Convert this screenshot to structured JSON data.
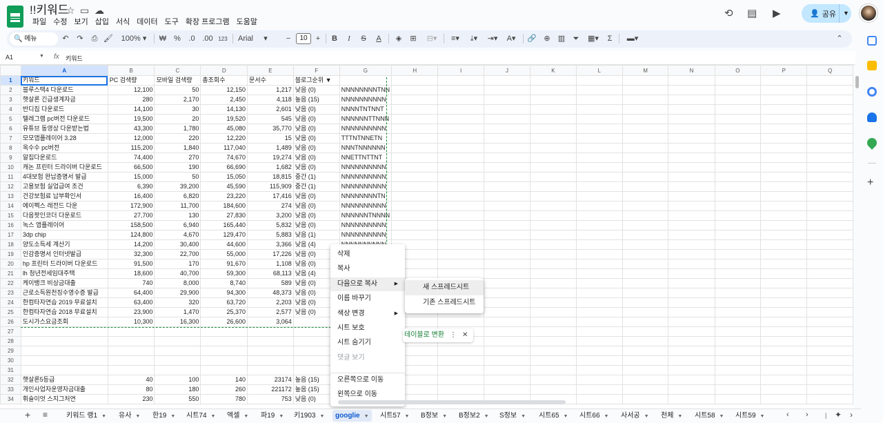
{
  "app": {
    "doc_title": "!!키워드",
    "menus": [
      "파일",
      "수정",
      "보기",
      "삽입",
      "서식",
      "데이터",
      "도구",
      "확장 프로그램",
      "도움말"
    ],
    "share_label": "공유"
  },
  "toolbar": {
    "menu_search": "메뉴",
    "zoom": "100%",
    "currency": "₩",
    "percent": "%",
    "dec_decrease": ".0",
    "dec_increase": ".00",
    "number_format": "123",
    "font": "Arial",
    "font_size": "10"
  },
  "formula": {
    "cell_ref": "A1",
    "value": "키워드"
  },
  "columns": [
    "A",
    "B",
    "C",
    "D",
    "E",
    "F",
    "G",
    "H",
    "I",
    "J",
    "K",
    "L",
    "M",
    "N",
    "O",
    "P",
    "Q"
  ],
  "rows": [
    {
      "n": "1",
      "a": "키워드",
      "b": "PC 검색량",
      "c": "모바일 검색량",
      "d": "총조회수",
      "e": "문서수",
      "f": "블로그순위 ▼",
      "g": ""
    },
    {
      "n": "2",
      "a": "블루스택4 다운로드",
      "b": "12,100",
      "c": "50",
      "d": "12,150",
      "e": "1,217",
      "f": "낮음 (0)",
      "g": "NNNNNNNNTNN"
    },
    {
      "n": "3",
      "a": "햇살론 긴급생계자금",
      "b": "280",
      "c": "2,170",
      "d": "2,450",
      "e": "4,118",
      "f": "높음 (15)",
      "g": "NNNNNNNNNN"
    },
    {
      "n": "4",
      "a": "반디집 다운로드",
      "b": "14,100",
      "c": "30",
      "d": "14,130",
      "e": "2,601",
      "f": "낮음 (0)",
      "g": "NNNNTNTNNT"
    },
    {
      "n": "5",
      "a": "텔레그램 pc버전 다운로드",
      "b": "19,500",
      "c": "20",
      "d": "19,520",
      "e": "545",
      "f": "낮음 (0)",
      "g": "NNNNNNTTNNN"
    },
    {
      "n": "6",
      "a": "유튜브 동영상 다운받는법",
      "b": "43,300",
      "c": "1,780",
      "d": "45,080",
      "e": "35,770",
      "f": "낮음 (0)",
      "g": "NNNNNNNNNN"
    },
    {
      "n": "7",
      "a": "모모앱플레이어 3.28",
      "b": "12,000",
      "c": "220",
      "d": "12,220",
      "e": "15",
      "f": "낮음 (0)",
      "g": "TTTNTNNETN"
    },
    {
      "n": "8",
      "a": "옥수수 pc버전",
      "b": "115,200",
      "c": "1,840",
      "d": "117,040",
      "e": "1,489",
      "f": "낮음 (0)",
      "g": "NNNTNNNNNN"
    },
    {
      "n": "9",
      "a": "알집다운로드",
      "b": "74,400",
      "c": "270",
      "d": "74,670",
      "e": "19,274",
      "f": "낮음 (0)",
      "g": "NNETTNTTNT"
    },
    {
      "n": "10",
      "a": "캐논 프린터 드라이버 다운로드",
      "b": "66,500",
      "c": "190",
      "d": "66,690",
      "e": "1,682",
      "f": "낮음 (0)",
      "g": "NNNNNNNNNN"
    },
    {
      "n": "11",
      "a": "4대보험 완납증명서 발급",
      "b": "15,000",
      "c": "50",
      "d": "15,050",
      "e": "18,815",
      "f": "중간 (1)",
      "g": "NNNNNNNNNN"
    },
    {
      "n": "12",
      "a": "고용보험 실업급여 조건",
      "b": "6,390",
      "c": "39,200",
      "d": "45,590",
      "e": "115,909",
      "f": "중간 (1)",
      "g": "NNNNNNNNNN"
    },
    {
      "n": "13",
      "a": "건강보험료 납부확인서",
      "b": "16,400",
      "c": "6,820",
      "d": "23,220",
      "e": "17,416",
      "f": "낮음 (0)",
      "g": "NNNNNNNNTN"
    },
    {
      "n": "14",
      "a": "에이펙스 레전드 다운",
      "b": "172,900",
      "c": "11,700",
      "d": "184,600",
      "e": "274",
      "f": "낮음 (0)",
      "g": "NNNNNNNNNN"
    },
    {
      "n": "15",
      "a": "다음팟인코더 다운로드",
      "b": "27,700",
      "c": "130",
      "d": "27,830",
      "e": "3,200",
      "f": "낮음 (0)",
      "g": "NNNNNNTNNNN"
    },
    {
      "n": "16",
      "a": "녹스 앱플레이어",
      "b": "158,500",
      "c": "6,940",
      "d": "165,440",
      "e": "5,832",
      "f": "낮음 (0)",
      "g": "NNNNNNNNNN"
    },
    {
      "n": "17",
      "a": "3dp chip",
      "b": "124,800",
      "c": "4,670",
      "d": "129,470",
      "e": "5,883",
      "f": "낮음 (1)",
      "g": "NNNNNNNNNN"
    },
    {
      "n": "18",
      "a": "양도소득세 계산기",
      "b": "14,200",
      "c": "30,400",
      "d": "44,600",
      "e": "3,366",
      "f": "낮음 (4)",
      "g": "NNNNNNNNNN"
    },
    {
      "n": "19",
      "a": "인감증명서 인터넷발급",
      "b": "32,300",
      "c": "22,700",
      "d": "55,000",
      "e": "17,226",
      "f": "낮음 (0)",
      "g": ""
    },
    {
      "n": "20",
      "a": "hp 프린터 드라이버 다운로드",
      "b": "91,500",
      "c": "170",
      "d": "91,670",
      "e": "1,108",
      "f": "낮음 (0)",
      "g": ""
    },
    {
      "n": "21",
      "a": "lh 청년전세임대주택",
      "b": "18,600",
      "c": "40,700",
      "d": "59,300",
      "e": "68,113",
      "f": "낮음 (4)",
      "g": ""
    },
    {
      "n": "22",
      "a": "케이뱅크 비상금대출",
      "b": "740",
      "c": "8,000",
      "d": "8,740",
      "e": "589",
      "f": "낮음 (0)",
      "g": ""
    },
    {
      "n": "23",
      "a": "근로소득원천징수영수증 발급",
      "b": "64,400",
      "c": "29,900",
      "d": "94,300",
      "e": "48,373",
      "f": "낮음 (0)",
      "g": ""
    },
    {
      "n": "24",
      "a": "한컴타자연습 2019 무료설치",
      "b": "63,400",
      "c": "320",
      "d": "63,720",
      "e": "2,203",
      "f": "낮음 (0)",
      "g": ""
    },
    {
      "n": "25",
      "a": "한컴타자연습 2018 무료설치",
      "b": "23,900",
      "c": "1,470",
      "d": "25,370",
      "e": "2,577",
      "f": "낮음 (0)",
      "g": ""
    },
    {
      "n": "26",
      "a": "도시가스요금조회",
      "b": "10,300",
      "c": "16,300",
      "d": "26,600",
      "e": "3,064",
      "f": "",
      "g": ""
    },
    {
      "n": "27",
      "a": "",
      "b": "",
      "c": "",
      "d": "",
      "e": "",
      "f": "",
      "g": ""
    },
    {
      "n": "28",
      "a": "",
      "b": "",
      "c": "",
      "d": "",
      "e": "",
      "f": "",
      "g": ""
    },
    {
      "n": "29",
      "a": "",
      "b": "",
      "c": "",
      "d": "",
      "e": "",
      "f": "",
      "g": ""
    },
    {
      "n": "30",
      "a": "",
      "b": "",
      "c": "",
      "d": "",
      "e": "",
      "f": "",
      "g": ""
    },
    {
      "n": "31",
      "a": "",
      "b": "",
      "c": "",
      "d": "",
      "e": "",
      "f": "",
      "g": ""
    },
    {
      "n": "32",
      "a": "햇살론5등급",
      "b": "40",
      "c": "100",
      "d": "140",
      "e": "23174",
      "f": "높음 (15)",
      "g": ""
    },
    {
      "n": "33",
      "a": "개인사업자운영자금대출",
      "b": "80",
      "c": "180",
      "d": "260",
      "e": "221172",
      "f": "높음 (15)",
      "g": ""
    },
    {
      "n": "34",
      "a": "휘슬이엇 스지그처연",
      "b": "230",
      "c": "550",
      "d": "780",
      "e": "753",
      "f": "낮음 (0)",
      "g": ""
    }
  ],
  "context_menu": {
    "items": [
      "삭제",
      "복사",
      "다음으로 복사",
      "이름 바꾸기",
      "색상 변경",
      "시트 보호",
      "시트 숨기기",
      "댓글 보기",
      "오른쪽으로 이동",
      "왼쪽으로 이동"
    ]
  },
  "submenu": {
    "items": [
      "새 스프레드시트",
      "기존 스프레드시트"
    ]
  },
  "convert_chip": {
    "label": "테이블로 변환"
  },
  "sheet_tabs": [
    "키워드 랭1",
    "유사",
    "한19",
    "시트74",
    "엑셀",
    "파19",
    "키1903",
    "googlie",
    "시트57",
    "B정보",
    "B정보2",
    "S정보",
    "시트65",
    "시트66",
    "사서공",
    "천체",
    "시트58",
    "시트59"
  ],
  "active_tab": "googlie"
}
